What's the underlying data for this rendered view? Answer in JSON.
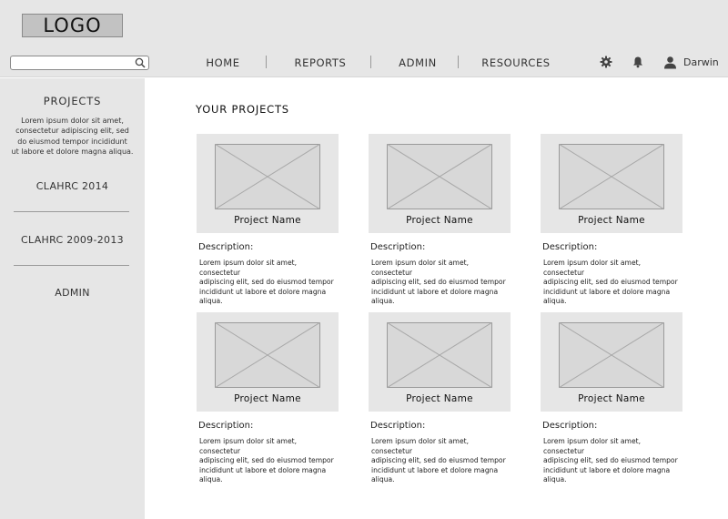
{
  "header": {
    "logo": "LOGO",
    "search": {
      "placeholder": "",
      "value": ""
    },
    "nav": [
      "HOME",
      "REPORTS",
      "ADMIN",
      "RESOURCES"
    ],
    "user": {
      "name": "Darwin"
    },
    "icons": [
      "gear-icon",
      "bell-icon",
      "user-icon",
      "search-icon"
    ]
  },
  "sidebar": {
    "title": "PROJECTS",
    "desc_lines": [
      "Lorem ipsum dolor sit amet,",
      "consectetur adipiscing elit, sed",
      "do eiusmod tempor incididunt",
      "ut labore et dolore magna aliqua."
    ],
    "items": [
      "CLAHRC 2014",
      "CLAHRC 2009-2013",
      "ADMIN"
    ]
  },
  "main": {
    "title": "YOUR PROJECTS",
    "cards": [
      {
        "name": "Project Name",
        "desc_label": "Description:",
        "desc_lines": [
          "Lorem ipsum dolor sit amet, consectetur",
          "adipiscing elit, sed do eiusmod tempor",
          "incididunt ut labore et dolore magna",
          "aliqua."
        ]
      },
      {
        "name": "Project Name",
        "desc_label": "Description:",
        "desc_lines": [
          "Lorem ipsum dolor sit amet, consectetur",
          "adipiscing elit, sed do eiusmod tempor",
          "incididunt ut labore et dolore magna",
          "aliqua."
        ]
      },
      {
        "name": "Project Name",
        "desc_label": "Description:",
        "desc_lines": [
          "Lorem ipsum dolor sit amet, consectetur",
          "adipiscing elit, sed do eiusmod tempor",
          "incididunt ut labore et dolore magna",
          "aliqua."
        ]
      },
      {
        "name": "Project Name",
        "desc_label": "Description:",
        "desc_lines": [
          "Lorem ipsum dolor sit amet, consectetur",
          "adipiscing elit, sed do eiusmod tempor",
          "incididunt ut labore et dolore magna",
          "aliqua."
        ]
      },
      {
        "name": "Project Name",
        "desc_label": "Description:",
        "desc_lines": [
          "Lorem ipsum dolor sit amet, consectetur",
          "adipiscing elit, sed do eiusmod tempor",
          "incididunt ut labore et dolore magna",
          "aliqua."
        ]
      },
      {
        "name": "Project Name",
        "desc_label": "Description:",
        "desc_lines": [
          "Lorem ipsum dolor sit amet, consectetur",
          "adipiscing elit, sed do eiusmod tempor",
          "incididunt ut labore et dolore magna",
          "aliqua."
        ]
      }
    ]
  },
  "colors": {
    "header_bg": "#e6e6e6",
    "sidebar_bg": "#e6e6e6",
    "card_bg": "#e6e6e6",
    "logo_bg": "#c2c2c2",
    "placeholder_bg": "#d8d8d8"
  }
}
